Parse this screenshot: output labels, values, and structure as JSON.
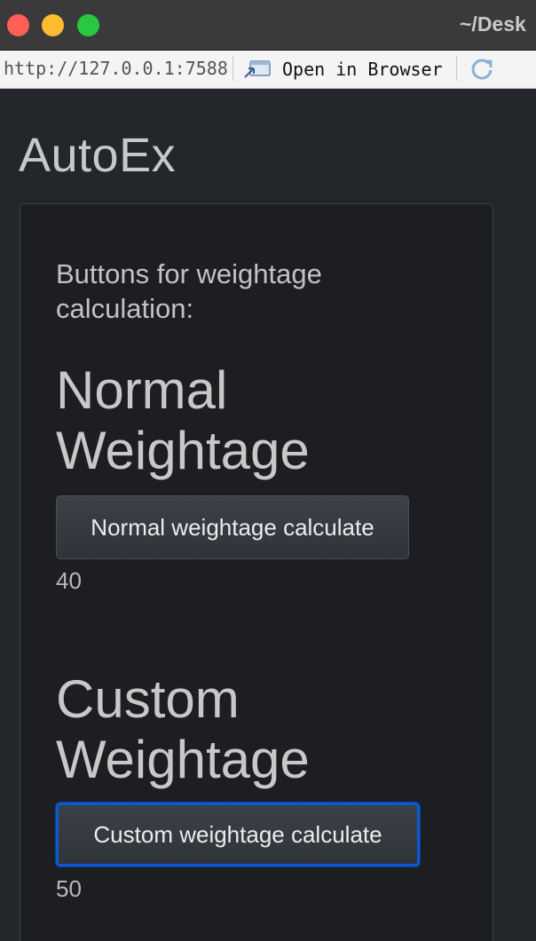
{
  "window": {
    "title": "~/Desk",
    "url": "http://127.0.0.1:7588",
    "open_browser_label": "Open in Browser",
    "open_browser_icon": "open-in-browser-icon",
    "refresh_icon": "refresh-icon"
  },
  "app": {
    "title": "AutoEx",
    "intro": "Buttons for weightage calculation:",
    "normal": {
      "heading": "Normal Weightage",
      "button_label": "Normal weightage calculate",
      "result": "40"
    },
    "custom": {
      "heading": "Custom Weightage",
      "button_label": "Custom weightage calculate",
      "result": "50"
    }
  },
  "colors": {
    "background": "#23262b",
    "panel": "#1c1e22",
    "focus_ring": "#0a5bd3"
  }
}
